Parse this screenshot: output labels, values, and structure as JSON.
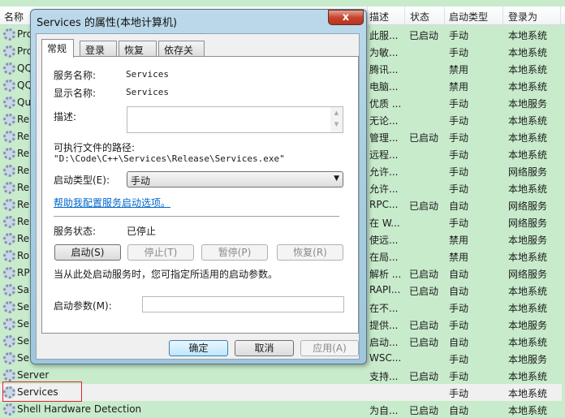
{
  "list": {
    "columns": [
      "名称",
      "描述",
      "状态",
      "启动类型",
      "登录为"
    ],
    "rows": [
      {
        "name": "Pro",
        "desc": "此服...",
        "status": "已启动",
        "startup": "手动",
        "logon": "本地系统"
      },
      {
        "name": "Pro",
        "desc": "为敏...",
        "status": "",
        "startup": "手动",
        "logon": "本地系统"
      },
      {
        "name": "QQ",
        "desc": "腾讯...",
        "status": "",
        "startup": "禁用",
        "logon": "本地系统"
      },
      {
        "name": "QQ",
        "desc": "电脑...",
        "status": "",
        "startup": "禁用",
        "logon": "本地系统"
      },
      {
        "name": "Qu",
        "desc": "优质 ...",
        "status": "",
        "startup": "手动",
        "logon": "本地服务"
      },
      {
        "name": "Re",
        "desc": "无论...",
        "status": "",
        "startup": "手动",
        "logon": "本地系统"
      },
      {
        "name": "Re",
        "desc": "管理...",
        "status": "已启动",
        "startup": "手动",
        "logon": "本地系统"
      },
      {
        "name": "Re",
        "desc": "远程...",
        "status": "",
        "startup": "手动",
        "logon": "本地系统"
      },
      {
        "name": "Re",
        "desc": "允许...",
        "status": "",
        "startup": "手动",
        "logon": "网络服务"
      },
      {
        "name": "Re",
        "desc": "允许...",
        "status": "",
        "startup": "手动",
        "logon": "本地系统"
      },
      {
        "name": "Re",
        "desc": "RPC...",
        "status": "已启动",
        "startup": "自动",
        "logon": "网络服务"
      },
      {
        "name": "Re",
        "desc": "在 W...",
        "status": "",
        "startup": "手动",
        "logon": "网络服务"
      },
      {
        "name": "Re",
        "desc": "使远...",
        "status": "",
        "startup": "禁用",
        "logon": "本地服务"
      },
      {
        "name": "Ro",
        "desc": "在局...",
        "status": "",
        "startup": "禁用",
        "logon": "本地系统"
      },
      {
        "name": "RP",
        "desc": "解析 ...",
        "status": "已启动",
        "startup": "自动",
        "logon": "网络服务"
      },
      {
        "name": "Sa",
        "desc": "RAPI...",
        "status": "已启动",
        "startup": "自动",
        "logon": "本地系统"
      },
      {
        "name": "Se",
        "desc": "在不...",
        "status": "",
        "startup": "手动",
        "logon": "本地系统"
      },
      {
        "name": "Se",
        "desc": "提供...",
        "status": "已启动",
        "startup": "手动",
        "logon": "本地服务"
      },
      {
        "name": "Se",
        "desc": "启动...",
        "status": "已启动",
        "startup": "自动",
        "logon": "本地系统"
      },
      {
        "name": "Se",
        "desc": "WSC...",
        "status": "",
        "startup": "手动",
        "logon": "本地服务"
      },
      {
        "name": "Server",
        "desc": "支持...",
        "status": "已启动",
        "startup": "手动",
        "logon": "本地系统"
      },
      {
        "name": "Services",
        "desc": "",
        "status": "",
        "startup": "手动",
        "logon": "本地系统",
        "selected": true
      },
      {
        "name": "Shell Hardware Detection",
        "desc": "为自...",
        "status": "已启动",
        "startup": "自动",
        "logon": "本地系统"
      }
    ]
  },
  "dialog": {
    "title": "Services 的属性(本地计算机)",
    "close_label": "x",
    "tabs": [
      "常规",
      "登录",
      "恢复",
      "依存关系"
    ],
    "service_name_label": "服务名称:",
    "service_name": "Services",
    "display_name_label": "显示名称:",
    "display_name": "Services",
    "description_label": "描述:",
    "path_label": "可执行文件的路径:",
    "path": "\"D:\\Code\\C++\\Services\\Release\\Services.exe\"",
    "startup_type_label": "启动类型(E):",
    "startup_type": "手动",
    "help_link": "帮助我配置服务启动选项。",
    "status_label": "服务状态:",
    "status": "已停止",
    "start_btn": "启动(S)",
    "stop_btn": "停止(T)",
    "pause_btn": "暂停(P)",
    "resume_btn": "恢复(R)",
    "hint": "当从此处启动服务时，您可指定所适用的启动参数。",
    "params_label": "启动参数(M):",
    "params_value": "",
    "ok": "确定",
    "cancel": "取消",
    "apply": "应用(A)"
  },
  "colors": {
    "list_bg": "#c8ebcc",
    "selection_box": "#e8232b",
    "link": "#0066cc"
  }
}
